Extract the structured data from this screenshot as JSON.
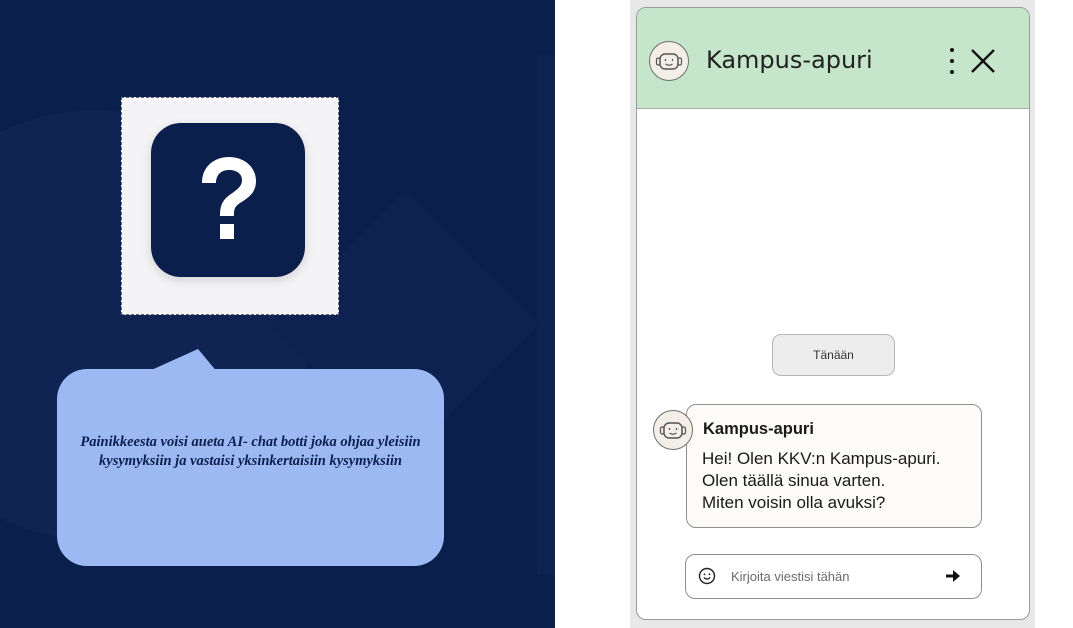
{
  "callout": {
    "text": "Painikkeesta voisi aueta AI- chat botti joka ohjaa yleisiin kysymyksiin ja vastaisi yksinkertaisiin kysymyksiin"
  },
  "help_button": {
    "icon": "question-mark-icon"
  },
  "chat": {
    "title": "Kampus-apuri",
    "header_icons": [
      "robot-avatar-icon",
      "kebab-menu-icon",
      "close-icon"
    ],
    "day_separator": "Tänään",
    "message": {
      "sender": "Kampus-apuri",
      "lines": [
        "Hei! Olen KKV:n Kampus-apuri.",
        "Olen täällä sinua varten.",
        "Miten voisin olla avuksi?"
      ]
    },
    "input": {
      "placeholder": "Kirjoita viestisi tähän",
      "value": ""
    }
  },
  "colors": {
    "left_background": "#0b1f4d",
    "callout_fill": "#9db9f3",
    "chat_header": "#c5e6cb"
  }
}
